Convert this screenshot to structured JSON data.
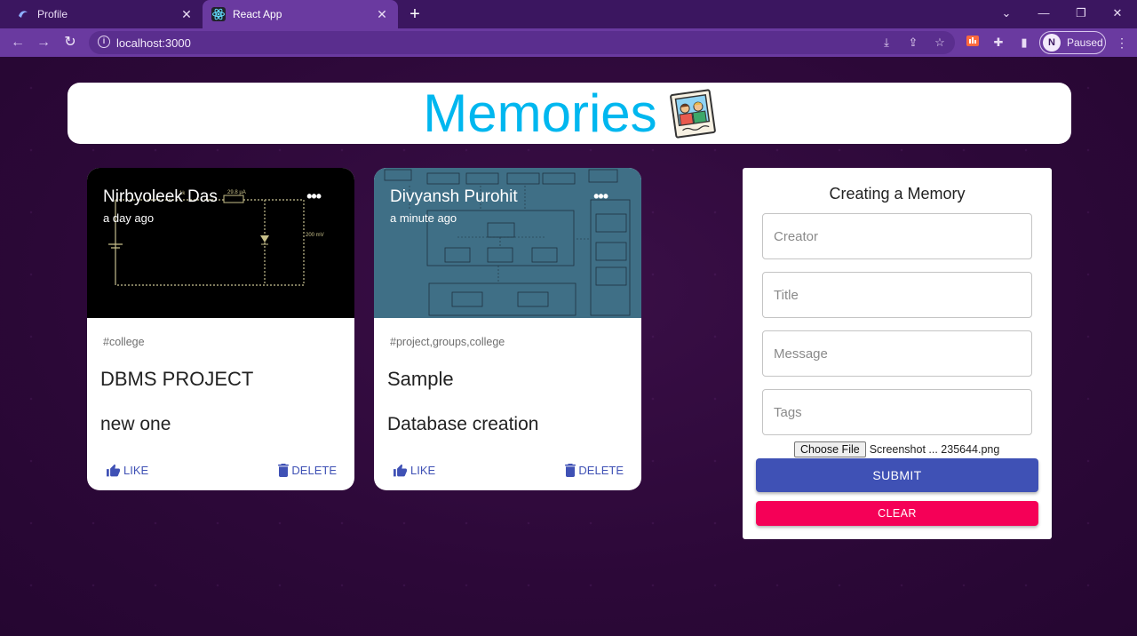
{
  "browser": {
    "tabs": [
      {
        "title": "Profile",
        "icon": "profile-favicon-icon"
      },
      {
        "title": "React App",
        "icon": "react-favicon-icon"
      }
    ],
    "url": "localhost:3000",
    "profile_initial": "N",
    "profile_status": "Paused"
  },
  "app": {
    "heading": "Memories",
    "logo": "memories-photo-logo"
  },
  "posts": [
    {
      "creator": "Nirbyoleek Das",
      "time": "a day ago",
      "tags": "#college",
      "title": "DBMS PROJECT",
      "message": "new one",
      "like_label": "LIKE",
      "delete_label": "DELETE"
    },
    {
      "creator": "Divyansh Purohit",
      "time": "a minute ago",
      "tags": "#project,groups,college",
      "title": "Sample",
      "message": "Database creation",
      "like_label": "LIKE",
      "delete_label": "DELETE"
    }
  ],
  "form": {
    "title": "Creating a Memory",
    "creator_placeholder": "Creator",
    "title_placeholder": "Title",
    "message_placeholder": "Message",
    "tags_placeholder": "Tags",
    "choose_file_label": "Choose File",
    "file_name": "Screenshot ... 235644.png",
    "submit_label": "SUBMIT",
    "clear_label": "CLEAR"
  },
  "colors": {
    "accent_primary": "#3f51b5",
    "accent_secondary": "#f50057",
    "heading": "#00b7ef",
    "background": "#2e0a3a"
  }
}
